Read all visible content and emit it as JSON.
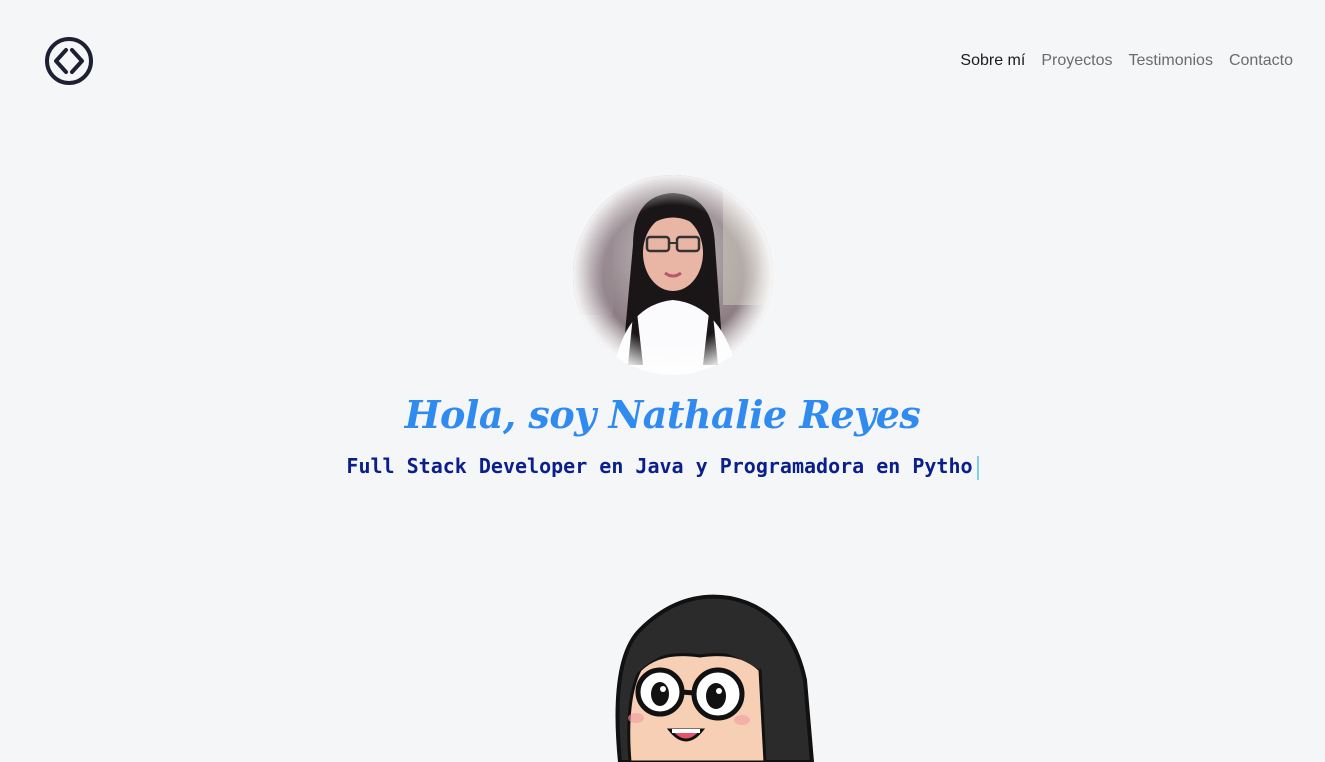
{
  "nav": {
    "items": [
      {
        "label": "Sobre mí",
        "active": true
      },
      {
        "label": "Proyectos",
        "active": false
      },
      {
        "label": "Testimonios",
        "active": false
      },
      {
        "label": "Contacto",
        "active": false
      }
    ]
  },
  "logo": {
    "icon": "code-brackets-icon"
  },
  "hero": {
    "title": "Hola, soy Nathalie Reyes",
    "subtitle": "Full Stack Developer en Java y Programadora en Pytho"
  },
  "colors": {
    "background": "#f5f6f8",
    "title": "#2f8bef",
    "subtitle": "#0b1f8c",
    "caret": "#7fd3e8",
    "logo": "#1e1f33"
  }
}
